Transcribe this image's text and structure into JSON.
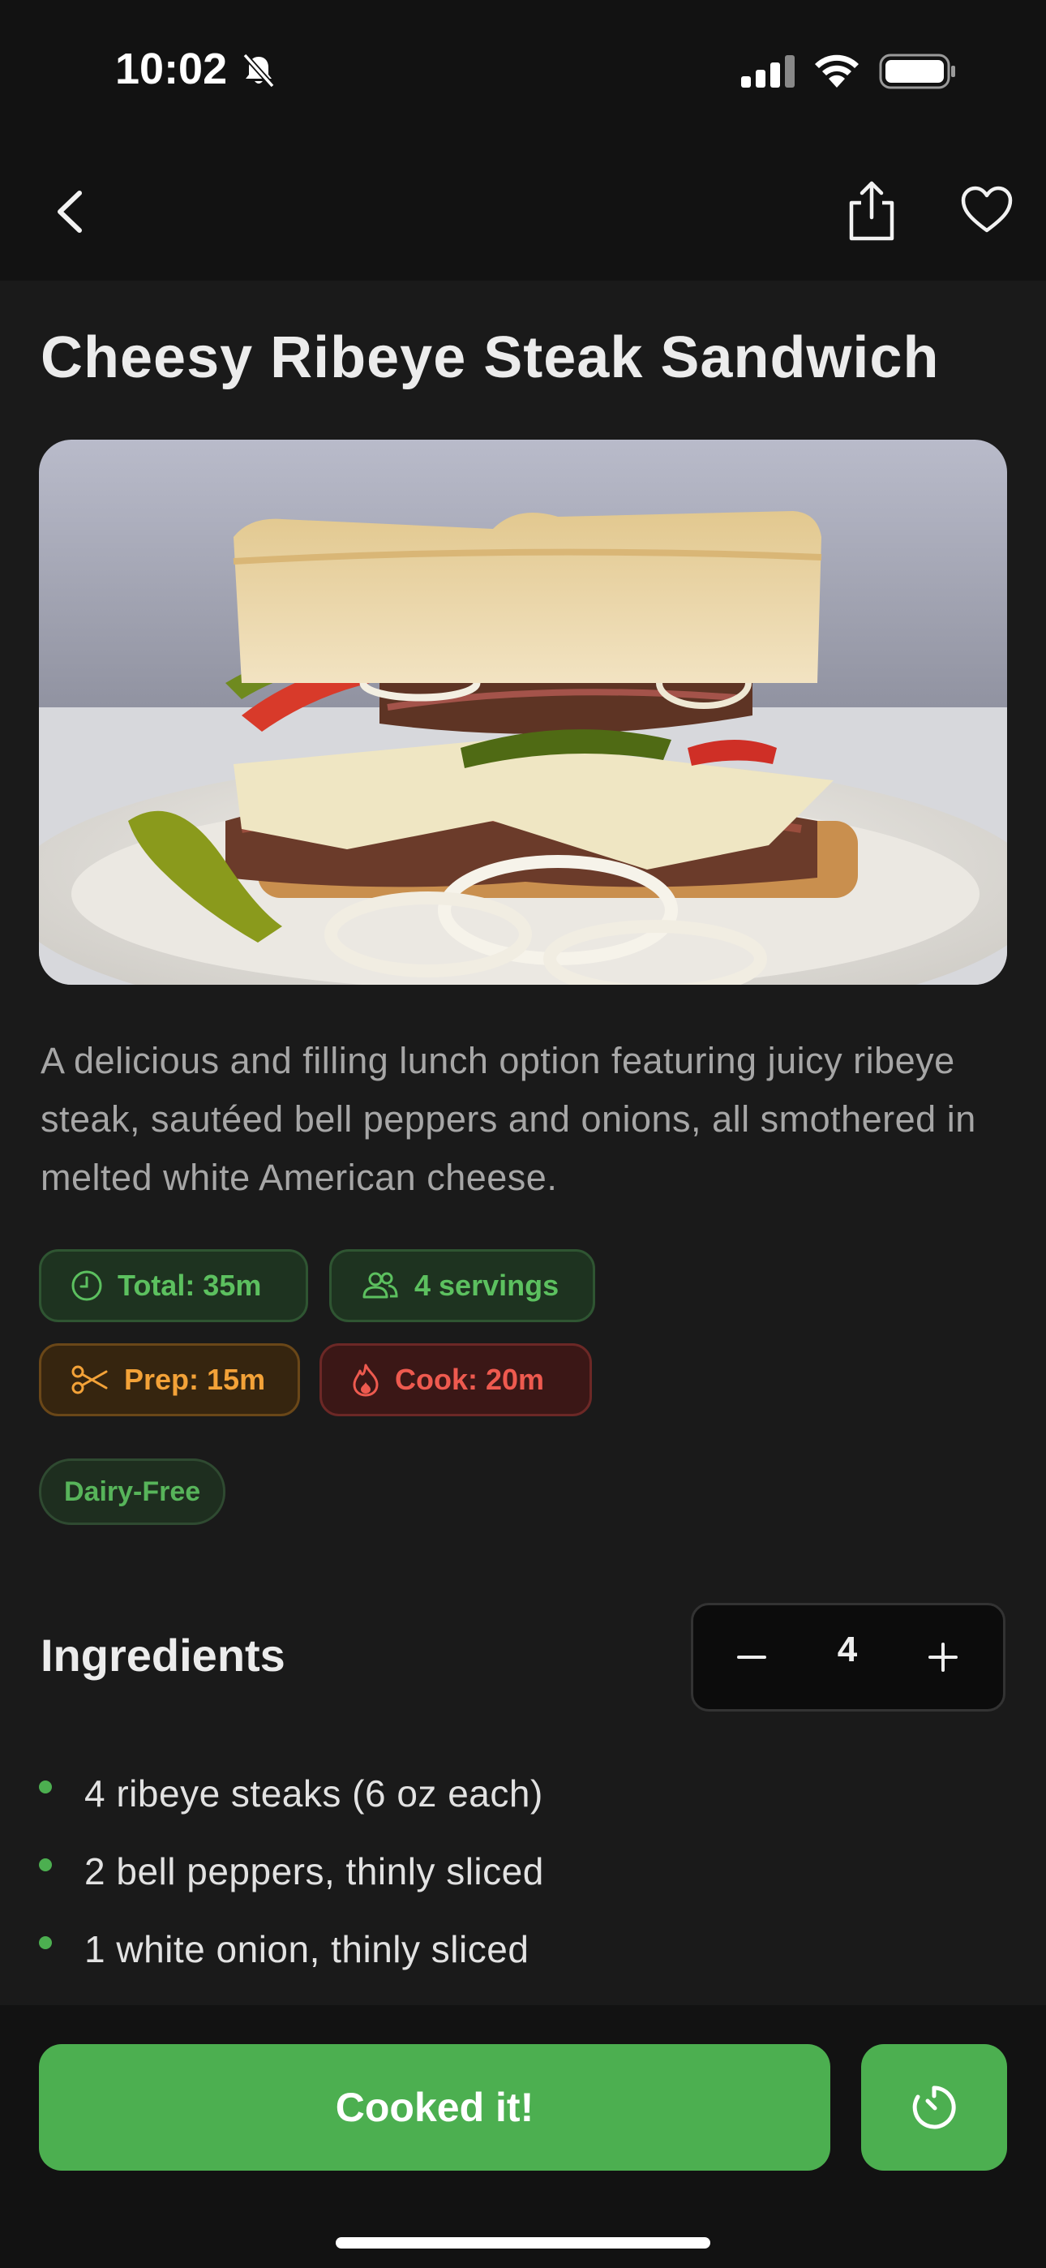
{
  "status_bar": {
    "time": "10:02"
  },
  "recipe": {
    "title": "Cheesy Ribeye Steak Sandwich",
    "description": "A delicious and filling lunch option featuring juicy ribeye steak, sautéed bell peppers and onions, all smothered in melted white American cheese.",
    "chips": {
      "total": "Total: 35m",
      "servings": "4 servings",
      "prep": "Prep: 15m",
      "cook": "Cook: 20m"
    },
    "diet_tags": [
      "Dairy-Free"
    ]
  },
  "ingredients": {
    "heading": "Ingredients",
    "servings_value": "4",
    "items": [
      "4 ribeye steaks (6 oz each)",
      "2 bell peppers, thinly sliced",
      "1 white onion, thinly sliced"
    ]
  },
  "actions": {
    "cooked_label": "Cooked it!"
  },
  "colors": {
    "accent": "#4caf50",
    "background": "#1a1a1a",
    "bar": "#121212"
  },
  "icons": [
    "bell-slash-icon",
    "signal-icon",
    "wifi-icon",
    "battery-icon",
    "chevron-left-icon",
    "share-icon",
    "heart-icon",
    "clock-icon",
    "people-icon",
    "scissors-icon",
    "flame-icon",
    "minus-icon",
    "plus-icon",
    "timer-icon"
  ]
}
